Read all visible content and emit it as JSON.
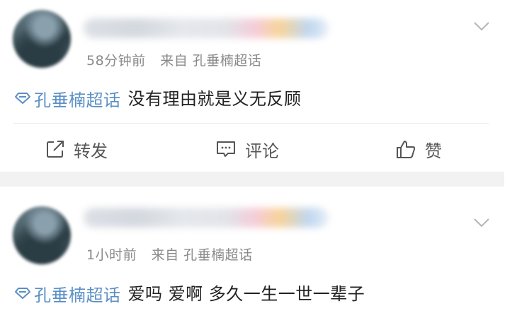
{
  "posts": [
    {
      "time": "58分钟前",
      "source": "来自 孔垂楠超话",
      "topic": "孔垂楠超话",
      "text": "没有理由就是义无反顾",
      "actions": {
        "repost": "转发",
        "comment": "评论",
        "like": "赞"
      }
    },
    {
      "time": "1小时前",
      "source": "来自 孔垂楠超话",
      "topic": "孔垂楠超话",
      "text": "爱吗 爱啊 多久一生一世一辈子"
    }
  ],
  "colors": {
    "topic": "#5a8fc6",
    "meta": "#8a8a8a",
    "separator": "#f2f2f2"
  },
  "icons": [
    "chevron-down-icon",
    "topic-diamond-icon",
    "repost-icon",
    "comment-icon",
    "like-icon"
  ]
}
